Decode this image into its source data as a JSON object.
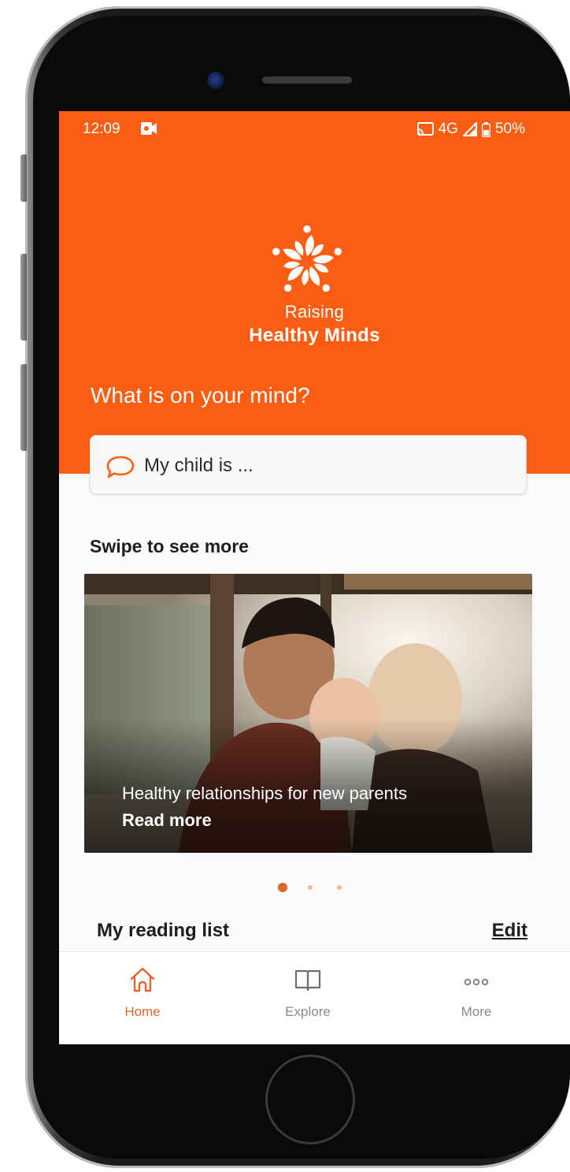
{
  "status_bar": {
    "time": "12:09",
    "network": "4G",
    "battery": "50%"
  },
  "brand": {
    "line1": "Raising",
    "line2": "Healthy Minds"
  },
  "prompt": {
    "question": "What is on your mind?",
    "input_value": "My child is ..."
  },
  "carousel": {
    "section_title": "Swipe to see more",
    "card": {
      "title": "Healthy relationships for new parents",
      "link": "Read more"
    },
    "page_count": 3,
    "active_index": 0
  },
  "reading_list": {
    "title": "My reading list",
    "edit_label": "Edit"
  },
  "nav": {
    "items": [
      {
        "label": "Home",
        "icon": "home-icon",
        "active": true
      },
      {
        "label": "Explore",
        "icon": "book-icon",
        "active": false
      },
      {
        "label": "More",
        "icon": "more-dots-icon",
        "active": false
      }
    ]
  },
  "colors": {
    "brand_orange": "#fb5d12",
    "nav_active": "#e0662a",
    "nav_inactive": "#8a8a8a"
  }
}
